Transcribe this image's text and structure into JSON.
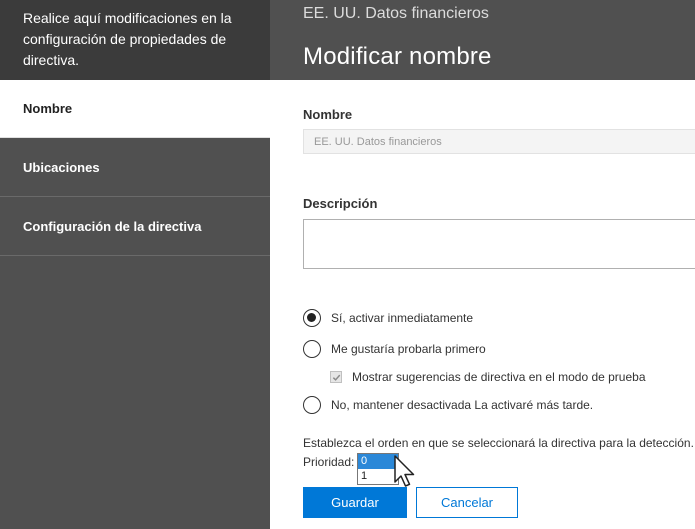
{
  "header": {
    "intro": "Realice aquí modificaciones en la configuración de propiedades de directiva.",
    "subtitle": "EE. UU. Datos financieros",
    "title": "Modificar nombre"
  },
  "sidebar": {
    "items": [
      {
        "label": "Nombre",
        "active": true
      },
      {
        "label": "Ubicaciones",
        "active": false
      },
      {
        "label": "Configuración de la directiva",
        "active": false
      }
    ]
  },
  "form": {
    "name_label": "Nombre",
    "name_value": "EE. UU. Datos financieros",
    "description_label": "Descripción",
    "description_value": "",
    "options": [
      {
        "label": "Sí, activar inmediatamente",
        "checked": true
      },
      {
        "label": "Me gustaría probarla primero",
        "checked": false
      },
      {
        "label": "No, mantener desactivada La activaré más tarde.",
        "checked": false
      }
    ],
    "test_mode_checkbox": {
      "label": "Mostrar sugerencias de directiva en el modo de prueba",
      "checked": true
    },
    "order_text": "Establezca el orden en que se seleccionará la directiva para la detección.",
    "priority_label": "Prioridad:",
    "priority_options": [
      "0",
      "1"
    ],
    "priority_selected": "0"
  },
  "buttons": {
    "save": "Guardar",
    "cancel": "Cancelar"
  },
  "colors": {
    "accent": "#0078d7",
    "sidebar": "#505050",
    "header_left": "#3b3b3b",
    "selected_option": "#2b88d8"
  },
  "icons": {
    "cursor": "mouse-pointer-icon",
    "check": "checkmark-icon"
  }
}
